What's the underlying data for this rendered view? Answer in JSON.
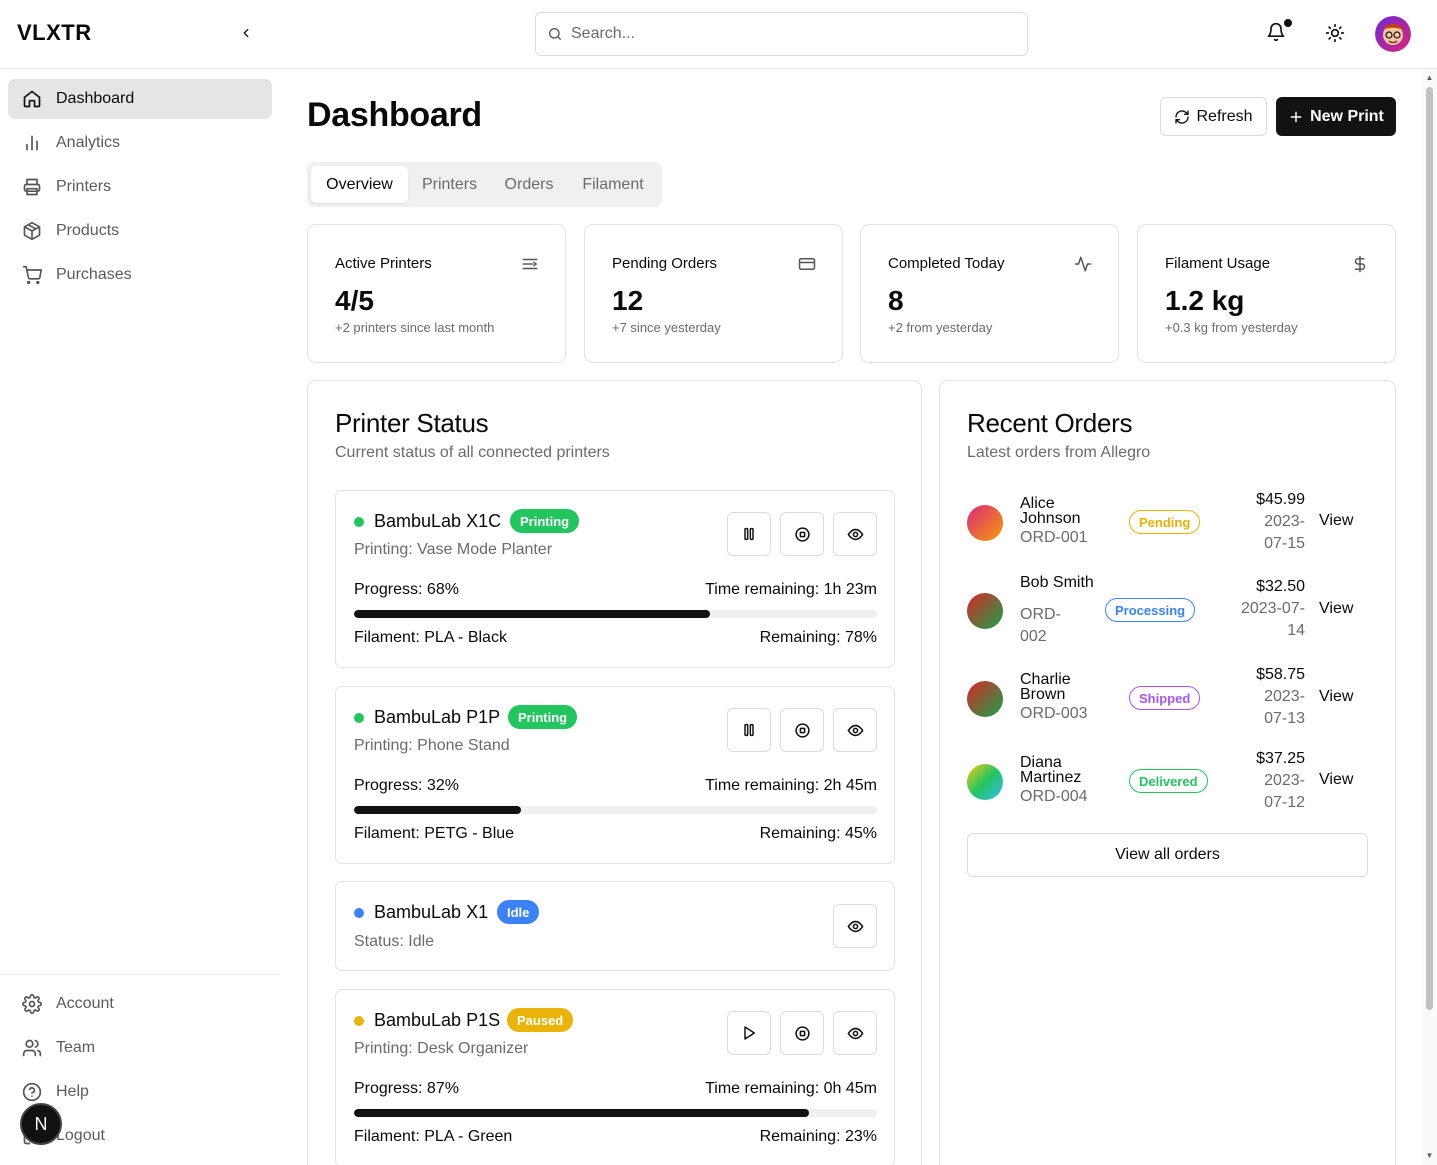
{
  "app": {
    "logo": "VLXTR"
  },
  "search": {
    "placeholder": "Search..."
  },
  "sidebar": {
    "items": [
      {
        "label": "Dashboard",
        "icon": "home-icon",
        "active": true
      },
      {
        "label": "Analytics",
        "icon": "bar-chart-icon"
      },
      {
        "label": "Printers",
        "icon": "printer-icon"
      },
      {
        "label": "Products",
        "icon": "package-icon"
      },
      {
        "label": "Purchases",
        "icon": "cart-icon"
      }
    ],
    "bottom": [
      {
        "label": "Account",
        "icon": "gear-icon"
      },
      {
        "label": "Team",
        "icon": "users-icon"
      },
      {
        "label": "Help",
        "icon": "help-icon"
      },
      {
        "label": "Logout",
        "icon": "logout-icon"
      }
    ],
    "badge": "N"
  },
  "header": {
    "title": "Dashboard",
    "refresh_label": "Refresh",
    "new_print_label": "New Print"
  },
  "tabs": [
    "Overview",
    "Printers",
    "Orders",
    "Filament"
  ],
  "stats": [
    {
      "title": "Active Printers",
      "value": "4/5",
      "sub": "+2 printers since last month",
      "icon": "list-icon"
    },
    {
      "title": "Pending Orders",
      "value": "12",
      "sub": "+7 since yesterday",
      "icon": "card-icon"
    },
    {
      "title": "Completed Today",
      "value": "8",
      "sub": "+2 from yesterday",
      "icon": "activity-icon"
    },
    {
      "title": "Filament Usage",
      "value": "1.2 kg",
      "sub": "+0.3 kg from yesterday",
      "icon": "dollar-icon"
    }
  ],
  "printer_status": {
    "title": "Printer Status",
    "subtitle": "Current status of all connected printers",
    "printers": [
      {
        "name": "BambuLab X1C",
        "status": "Printing",
        "job": "Printing: Vase Mode Planter",
        "progress_label": "Progress: 68%",
        "progress": 0.68,
        "time": "Time remaining: 1h 23m",
        "filament": "Filament: PLA - Black",
        "remaining": "Remaining: 78%"
      },
      {
        "name": "BambuLab P1P",
        "status": "Printing",
        "job": "Printing: Phone Stand",
        "progress_label": "Progress: 32%",
        "progress": 0.32,
        "time": "Time remaining: 2h 45m",
        "filament": "Filament: PETG - Blue",
        "remaining": "Remaining: 45%"
      },
      {
        "name": "BambuLab X1",
        "status": "Idle",
        "job": "Status: Idle"
      },
      {
        "name": "BambuLab P1S",
        "status": "Paused",
        "job": "Printing: Desk Organizer",
        "progress_label": "Progress: 87%",
        "progress": 0.87,
        "time": "Time remaining: 0h 45m",
        "filament": "Filament: PLA - Green",
        "remaining": "Remaining: 23%"
      }
    ]
  },
  "recent_orders": {
    "title": "Recent Orders",
    "subtitle": "Latest orders from Allegro",
    "orders": [
      {
        "name": "Alice Johnson",
        "id": "ORD-001",
        "status": "Pending",
        "amount": "$45.99",
        "date": "2023-07-15",
        "view": "View"
      },
      {
        "name": "Bob Smith",
        "id": "ORD-002",
        "status": "Processing",
        "amount": "$32.50",
        "date": "2023-07-14",
        "view": "View"
      },
      {
        "name": "Charlie Brown",
        "id": "ORD-003",
        "status": "Shipped",
        "amount": "$58.75",
        "date": "2023-07-13",
        "view": "View"
      },
      {
        "name": "Diana Martinez",
        "id": "ORD-004",
        "status": "Delivered",
        "amount": "$37.25",
        "date": "2023-07-12",
        "view": "View"
      }
    ],
    "view_all_label": "View all orders"
  },
  "colors": {
    "printing": "#22c55e",
    "idle": "#3b82f6",
    "paused": "#eab308",
    "pending": "#eab308",
    "processing": "#3b82f6",
    "shipped": "#a855f7",
    "delivered": "#22c55e"
  }
}
